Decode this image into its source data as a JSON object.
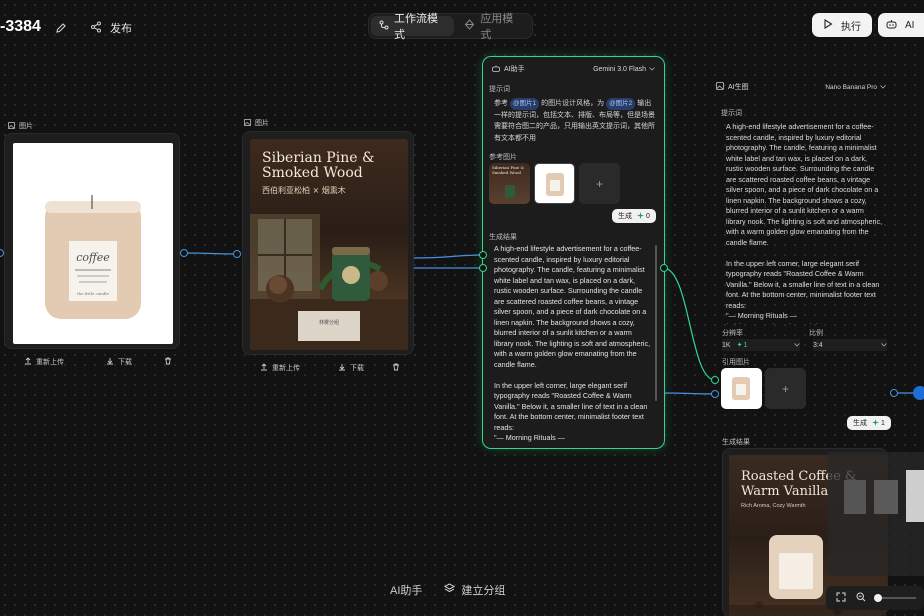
{
  "header": {
    "title": "-3384",
    "publish_label": "发布",
    "modes": [
      {
        "label": "工作流模式",
        "active": true
      },
      {
        "label": "应用模式",
        "active": false
      }
    ],
    "run_label": "执行",
    "ai_label": "AI"
  },
  "image_node_1": {
    "label": "图片",
    "upload_label": "重新上传",
    "download_label": "下载",
    "product_brand": "coffee",
    "product_small_text": "the little candle"
  },
  "image_node_2": {
    "label": "图片",
    "poster_title": "Siberian Pine & Smoked Wood",
    "poster_subtitle": "西伯利亚松柏 × 烟熏木",
    "poster_footer": "林雾分组",
    "upload_label": "重新上传",
    "download_label": "下载"
  },
  "ai_assistant_panel": {
    "title": "AI助手",
    "model": "Gemini 3.0 Flash",
    "prompt_label": "提示词",
    "prompt_parts": [
      "参考",
      "@图片1",
      "的图片设计风格，为",
      "@图片2",
      "输出一样的提示词，包括文本、排版、布局等，但是场景需要符合图二的产品，只用输出英文提示词，其他所有文本都不用"
    ],
    "ref_label": "参考图片",
    "ref_thumb_text": "Siberian Pine & Smoked Wood",
    "generate_label": "生成",
    "generate_count": "0",
    "result_label": "生成结果",
    "result_text": "A high-end lifestyle advertisement for a coffee-scented candle, inspired by luxury editorial photography. The candle, featuring a minimalist white label and tan wax, is placed on a dark, rustic wooden surface. Surrounding the candle are scattered roasted coffee beans, a vintage silver spoon, and a piece of dark chocolate on a linen napkin. The background shows a cozy, blurred interior of a sunlit kitchen or a warm library nook. The lighting is soft and atmospheric, with a warm golden glow emanating from the candle flame.\n\nIn the upper left corner, large elegant serif typography reads \"Roasted Coffee & Warm Vanilla.\" Below it, a smaller line of text in a clean font. At the bottom center, minimalist footer text reads:\n\"— Morning Rituals —\n/ Living Room / Study Nook /\""
  },
  "ai_image_panel": {
    "title": "AI生图",
    "model": "Nano Banana Pro",
    "prompt_label": "提示词",
    "prompt_text": "A high-end lifestyle advertisement for a coffee-scented candle, inspired by luxury editorial photography. The candle, featuring a minimalist white label and tan wax, is placed on a dark, rustic wooden surface. Surrounding the candle are scattered roasted coffee beans, a vintage silver spoon, and a piece of dark chocolate on a linen napkin. The background shows a cozy, blurred interior of a sunlit kitchen or a warm library nook. The lighting is soft and atmospheric, with a warm golden glow emanating from the candle flame.\n\nIn the upper left corner, large elegant serif typography reads \"Roasted Coffee & Warm Vanilla.\" Below it, a smaller line of text in a clean font. At the bottom center, minimalist footer text reads:\n\"— Morning Rituals —\n/ Living Room / Study Nook /\"",
    "resolution_label": "分辨率",
    "resolution_value": "1K",
    "resolution_badge": "1",
    "ratio_label": "比例",
    "ratio_value": "3:4",
    "ref_label": "引用图片",
    "generate_label": "生成",
    "generate_count": "1",
    "result_label": "生成结果",
    "result_title": "Roasted Coffee & Warm Vanilla",
    "result_subtitle": "Rich Aroma, Cozy Warmth"
  },
  "bottom": {
    "ai_assistant_label": "AI助手",
    "group_label": "建立分组"
  },
  "colors": {
    "accent_green": "#2fd68c",
    "port_blue": "#4a90e2",
    "chip_bg": "#2b3d66"
  }
}
